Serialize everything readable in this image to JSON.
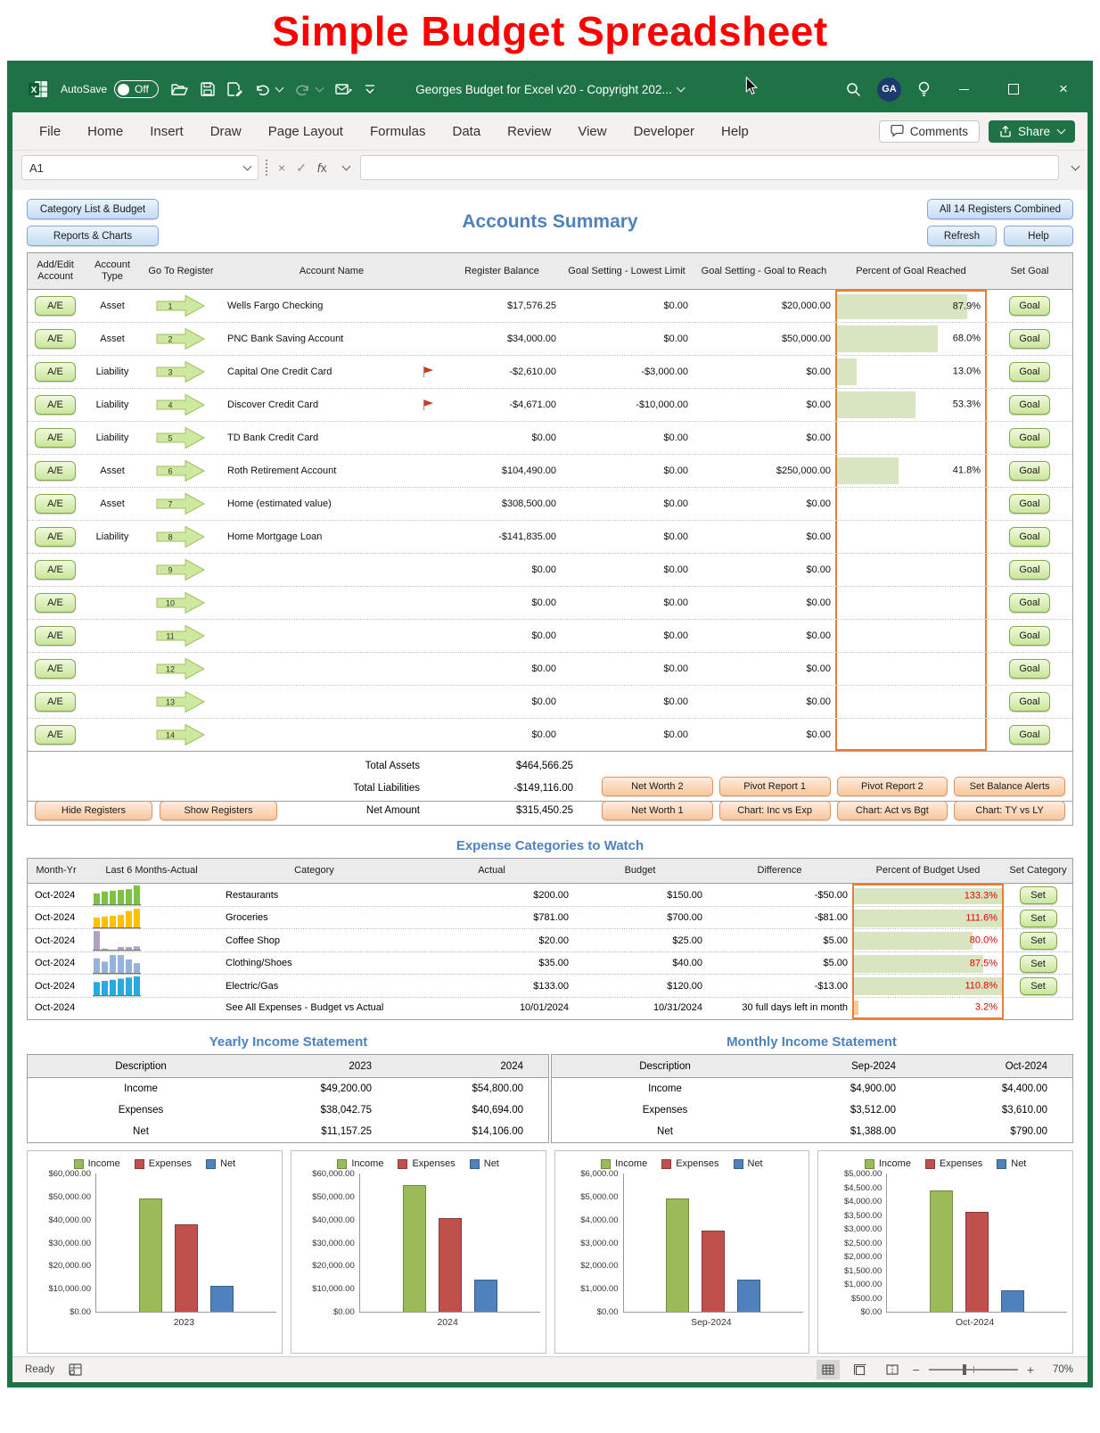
{
  "page_title": "Simple Budget Spreadsheet",
  "window": {
    "title": "Georges Budget for Excel v20 - Copyright 202...",
    "autosave_label": "AutoSave",
    "autosave_state": "Off",
    "avatar": "GA",
    "name_box": "A1"
  },
  "icons": {
    "close_glyph": "×",
    "check_glyph": "✓",
    "fx_label": "fx",
    "minimize_glyph": "",
    "search": "search",
    "lightbulb": "ideas"
  },
  "menu": [
    "File",
    "Home",
    "Insert",
    "Draw",
    "Page Layout",
    "Formulas",
    "Data",
    "Review",
    "View",
    "Developer",
    "Help"
  ],
  "ribbon": {
    "comments_label": "Comments",
    "share_label": "Share"
  },
  "toolbar_left": [
    "Category List & Budget",
    "Reports & Charts"
  ],
  "sheet_title": "Accounts Summary",
  "toolbar_right": [
    "All 14 Registers Combined",
    "Refresh",
    "Help"
  ],
  "accounts": {
    "headers": [
      "Add/Edit Account",
      "Account Type",
      "Go To Register",
      "Account Name",
      "Register Balance",
      "Goal Setting - Lowest Limit",
      "Goal Setting - Goal to Reach",
      "Percent of Goal Reached",
      "Set Goal"
    ],
    "ae_label": "A/E",
    "goal_label": "Goal",
    "rows": [
      {
        "type": "Asset",
        "num": "1",
        "name": "Wells Fargo Checking",
        "flag": false,
        "balance": "$17,576.25",
        "lowest": "$0.00",
        "goal": "$20,000.00",
        "pct_label": "87.9%",
        "pct": 87.9
      },
      {
        "type": "Asset",
        "num": "2",
        "name": "PNC Bank Saving Account",
        "flag": false,
        "balance": "$34,000.00",
        "lowest": "$0.00",
        "goal": "$50,000.00",
        "pct_label": "68.0%",
        "pct": 68.0
      },
      {
        "type": "Liability",
        "num": "3",
        "name": "Capital One Credit Card",
        "flag": true,
        "balance": "-$2,610.00",
        "lowest": "-$3,000.00",
        "goal": "$0.00",
        "pct_label": "13.0%",
        "pct": 13.0
      },
      {
        "type": "Liability",
        "num": "4",
        "name": "Discover Credit Card",
        "flag": true,
        "balance": "-$4,671.00",
        "lowest": "-$10,000.00",
        "goal": "$0.00",
        "pct_label": "53.3%",
        "pct": 53.3
      },
      {
        "type": "Liability",
        "num": "5",
        "name": "TD Bank Credit Card",
        "flag": false,
        "balance": "$0.00",
        "lowest": "$0.00",
        "goal": "$0.00",
        "pct_label": "",
        "pct": 0
      },
      {
        "type": "Asset",
        "num": "6",
        "name": "Roth Retirement Account",
        "flag": false,
        "balance": "$104,490.00",
        "lowest": "$0.00",
        "goal": "$250,000.00",
        "pct_label": "41.8%",
        "pct": 41.8
      },
      {
        "type": "Asset",
        "num": "7",
        "name": "Home (estimated value)",
        "flag": false,
        "balance": "$308,500.00",
        "lowest": "$0.00",
        "goal": "$0.00",
        "pct_label": "",
        "pct": 0
      },
      {
        "type": "Liability",
        "num": "8",
        "name": "Home Mortgage Loan",
        "flag": false,
        "balance": "-$141,835.00",
        "lowest": "$0.00",
        "goal": "$0.00",
        "pct_label": "",
        "pct": 0
      },
      {
        "type": "",
        "num": "9",
        "name": "",
        "flag": false,
        "balance": "$0.00",
        "lowest": "$0.00",
        "goal": "$0.00",
        "pct_label": "",
        "pct": 0
      },
      {
        "type": "",
        "num": "10",
        "name": "",
        "flag": false,
        "balance": "$0.00",
        "lowest": "$0.00",
        "goal": "$0.00",
        "pct_label": "",
        "pct": 0
      },
      {
        "type": "",
        "num": "11",
        "name": "",
        "flag": false,
        "balance": "$0.00",
        "lowest": "$0.00",
        "goal": "$0.00",
        "pct_label": "",
        "pct": 0
      },
      {
        "type": "",
        "num": "12",
        "name": "",
        "flag": false,
        "balance": "$0.00",
        "lowest": "$0.00",
        "goal": "$0.00",
        "pct_label": "",
        "pct": 0
      },
      {
        "type": "",
        "num": "13",
        "name": "",
        "flag": false,
        "balance": "$0.00",
        "lowest": "$0.00",
        "goal": "$0.00",
        "pct_label": "",
        "pct": 0
      },
      {
        "type": "",
        "num": "14",
        "name": "",
        "flag": false,
        "balance": "$0.00",
        "lowest": "$0.00",
        "goal": "$0.00",
        "pct_label": "",
        "pct": 0
      }
    ],
    "totals": [
      {
        "label": "Total Assets",
        "value": "$464,566.25"
      },
      {
        "label": "Total Liabilities",
        "value": "-$149,116.00"
      },
      {
        "label": "Net Amount",
        "value": "$315,450.25"
      }
    ],
    "footer_buttons_left": [
      "Hide Registers",
      "Show Registers"
    ],
    "footer_buttons_right": [
      [
        "Net Worth 2",
        "Pivot Report 1",
        "Pivot Report 2",
        "Set Balance Alerts"
      ],
      [
        "Net Worth 1",
        "Chart: Inc vs Exp",
        "Chart: Act vs Bgt",
        "Chart: TY vs LY"
      ]
    ]
  },
  "expenses": {
    "title": "Expense Categories to Watch",
    "headers": [
      "Month-Yr",
      "Last 6 Months-Actual",
      "Category",
      "Actual",
      "Budget",
      "Difference",
      "Percent of Budget Used",
      "Set Category"
    ],
    "set_label": "Set",
    "rows": [
      {
        "month": "Oct-2024",
        "spark": [
          58,
          68,
          72,
          76,
          80,
          100
        ],
        "spark_color": "#7DC242",
        "category": "Restaurants",
        "actual": "$200.00",
        "budget": "$150.00",
        "diff": "-$50.00",
        "pct_label": "133.3%",
        "pct": 100
      },
      {
        "month": "Oct-2024",
        "spark": [
          52,
          58,
          62,
          66,
          88,
          100
        ],
        "spark_color": "#FFC000",
        "category": "Groceries",
        "actual": "$781.00",
        "budget": "$700.00",
        "diff": "-$81.00",
        "pct_label": "111.6%",
        "pct": 100
      },
      {
        "month": "Oct-2024",
        "spark": [
          100,
          6,
          0,
          14,
          14,
          18
        ],
        "spark_color": "#B2A1C7",
        "category": "Coffee Shop",
        "actual": "$20.00",
        "budget": "$25.00",
        "diff": "$5.00",
        "pct_label": "80.0%",
        "pct": 80
      },
      {
        "month": "Oct-2024",
        "spark": [
          78,
          60,
          95,
          95,
          72,
          52
        ],
        "spark_color": "#95B3D7",
        "category": "Clothing/Shoes",
        "actual": "$35.00",
        "budget": "$40.00",
        "diff": "$5.00",
        "pct_label": "87.5%",
        "pct": 87.5
      },
      {
        "month": "Oct-2024",
        "spark": [
          70,
          76,
          82,
          88,
          94,
          100
        ],
        "spark_color": "#27AAE1",
        "category": "Electric/Gas",
        "actual": "$133.00",
        "budget": "$120.00",
        "diff": "-$13.00",
        "pct_label": "110.8%",
        "pct": 100
      }
    ],
    "summary": {
      "month": "Oct-2024",
      "category": "See All Expenses - Budget vs Actual",
      "actual": "10/01/2024",
      "budget": "10/31/2024",
      "diff": "30 full days left in month",
      "pct_label": "3.2%",
      "pct": 3.2
    }
  },
  "yearly": {
    "title": "Yearly Income Statement",
    "headers": [
      "Description",
      "2023",
      "2024"
    ],
    "rows": [
      [
        "Income",
        "$49,200.00",
        "$54,800.00"
      ],
      [
        "Expenses",
        "$38,042.75",
        "$40,694.00"
      ],
      [
        "Net",
        "$11,157.25",
        "$14,106.00"
      ]
    ]
  },
  "monthly": {
    "title": "Monthly Income Statement",
    "headers": [
      "Description",
      "Sep-2024",
      "Oct-2024"
    ],
    "rows": [
      [
        "Income",
        "$4,900.00",
        "$4,400.00"
      ],
      [
        "Expenses",
        "$3,512.00",
        "$3,610.00"
      ],
      [
        "Net",
        "$1,388.00",
        "$790.00"
      ]
    ]
  },
  "chart_data": [
    {
      "type": "bar",
      "xlabel": "2023",
      "legend": [
        "Income",
        "Expenses",
        "Net"
      ],
      "values": [
        49200,
        38042.75,
        11157.25
      ],
      "ylim": [
        0,
        60000
      ],
      "ytick_step": 10000,
      "colors": [
        "#9BBB59",
        "#C0504D",
        "#4F81BD"
      ],
      "border_colors": [
        "#71893F",
        "#8B3A38",
        "#36608E"
      ]
    },
    {
      "type": "bar",
      "xlabel": "2024",
      "legend": [
        "Income",
        "Expenses",
        "Net"
      ],
      "values": [
        54800,
        40694,
        14106
      ],
      "ylim": [
        0,
        60000
      ],
      "ytick_step": 10000,
      "colors": [
        "#9BBB59",
        "#C0504D",
        "#4F81BD"
      ],
      "border_colors": [
        "#71893F",
        "#8B3A38",
        "#36608E"
      ]
    },
    {
      "type": "bar",
      "xlabel": "Sep-2024",
      "legend": [
        "Income",
        "Expenses",
        "Net"
      ],
      "values": [
        4900,
        3512,
        1388
      ],
      "ylim": [
        0,
        6000
      ],
      "ytick_step": 1000,
      "colors": [
        "#9BBB59",
        "#C0504D",
        "#4F81BD"
      ],
      "border_colors": [
        "#71893F",
        "#8B3A38",
        "#36608E"
      ]
    },
    {
      "type": "bar",
      "xlabel": "Oct-2024",
      "legend": [
        "Income",
        "Expenses",
        "Net"
      ],
      "values": [
        4400,
        3610,
        790
      ],
      "ylim": [
        0,
        5000
      ],
      "ytick_step": 500,
      "colors": [
        "#9BBB59",
        "#C0504D",
        "#4F81BD"
      ],
      "border_colors": [
        "#71893F",
        "#8B3A38",
        "#36608E"
      ]
    }
  ],
  "status": {
    "ready": "Ready",
    "zoom": "70%"
  }
}
